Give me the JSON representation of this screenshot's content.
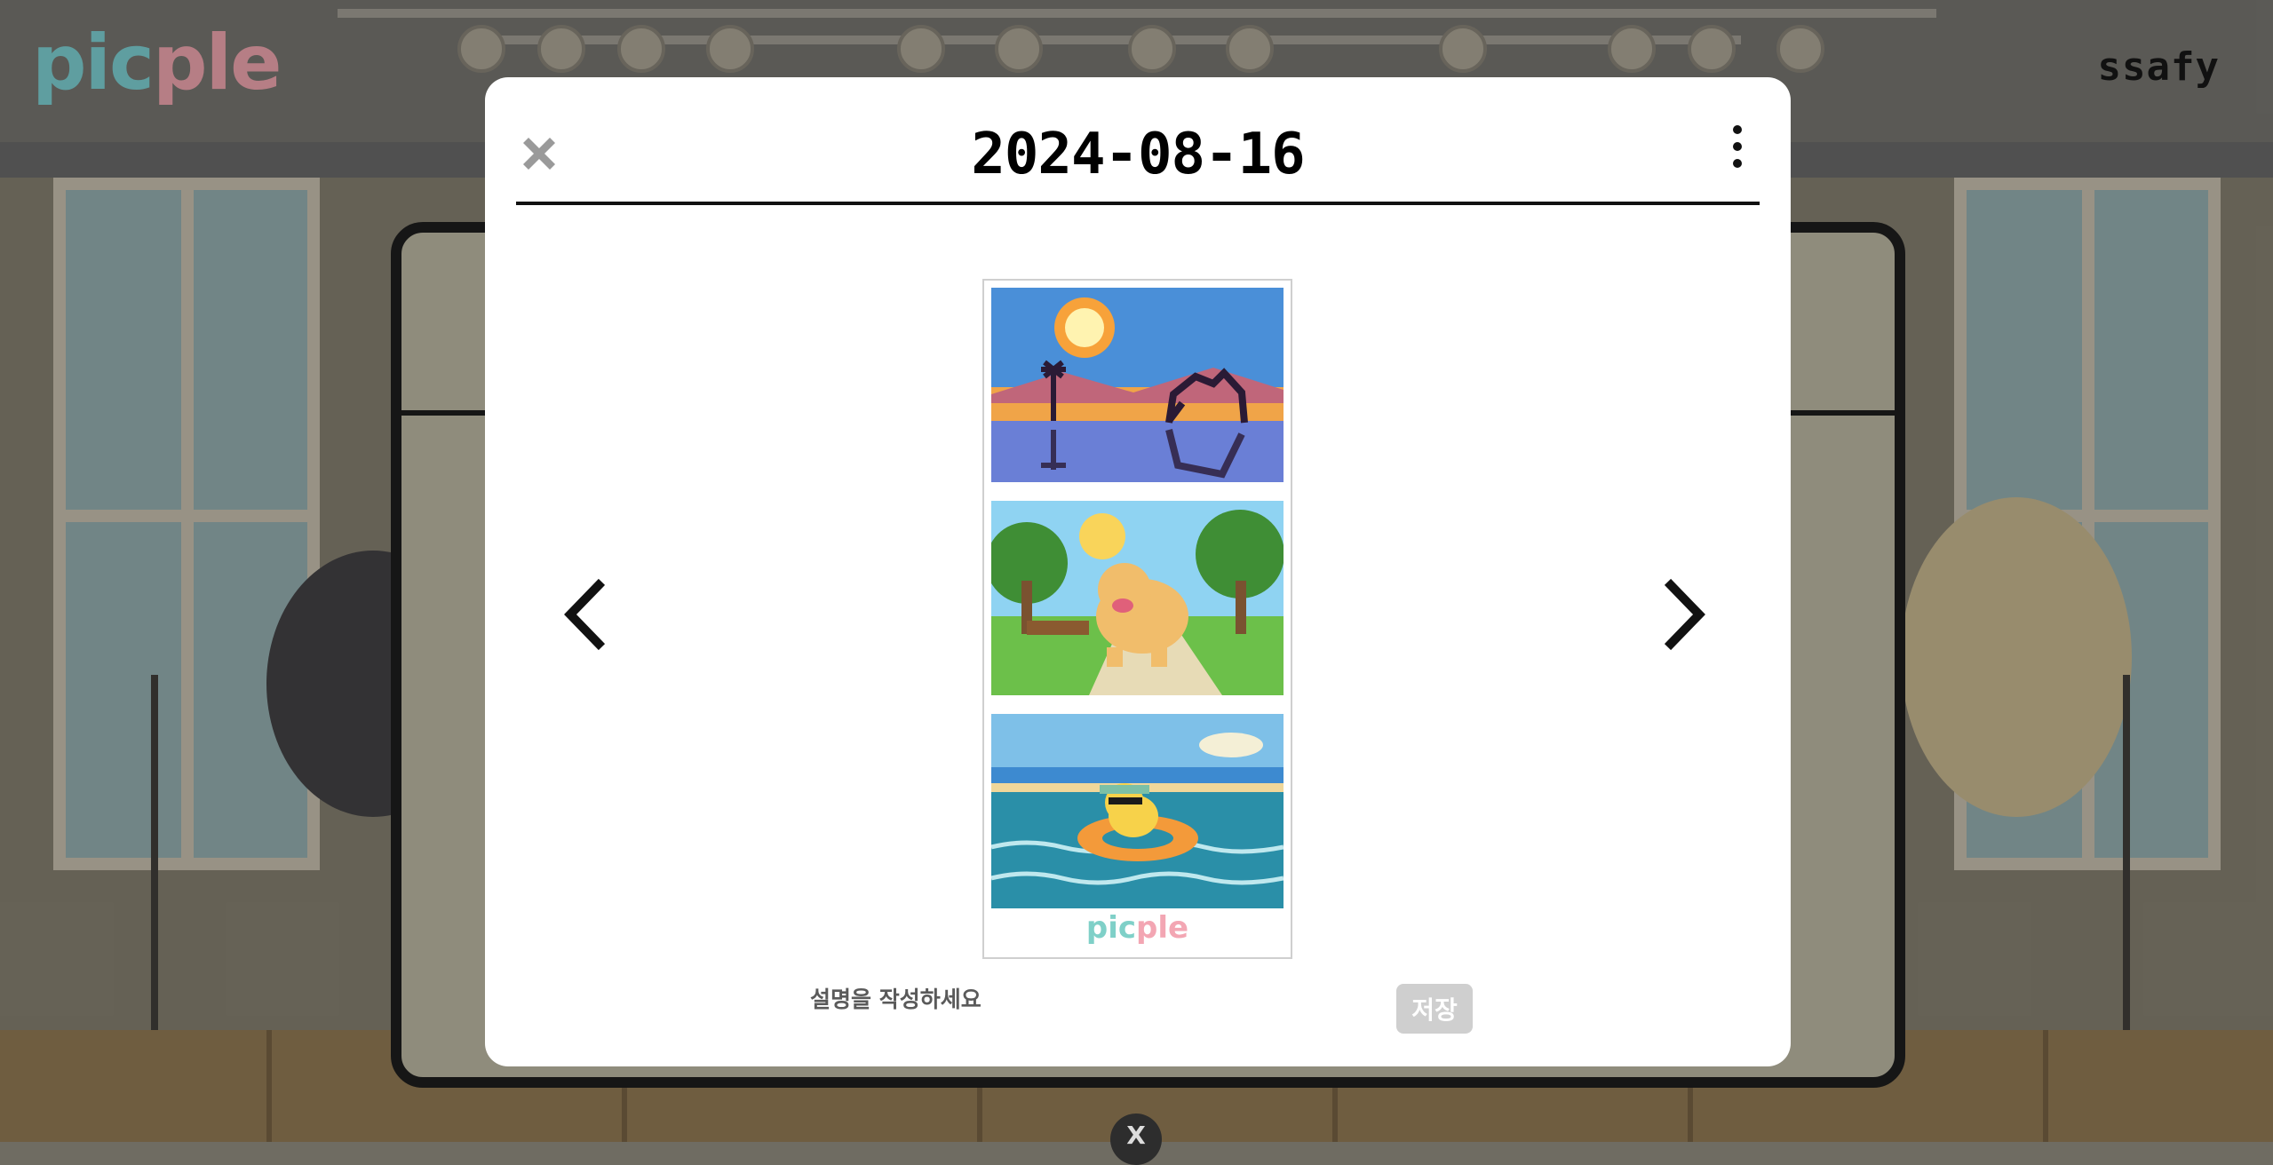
{
  "app": {
    "logo_pic": "pic",
    "logo_ple": "ple",
    "user_name": "ssafy"
  },
  "modal": {
    "title": "2024-08-16",
    "close_icon": "close-x-icon",
    "more_icon": "vertical-ellipsis-icon",
    "prev_icon": "chevron-left-icon",
    "next_icon": "chevron-right-icon",
    "photos": [
      {
        "name": "camel-oasis-pixel-art"
      },
      {
        "name": "golden-retriever-park-pixel-art"
      },
      {
        "name": "duck-float-sea-pixel-art"
      }
    ],
    "strip_logo_pic": "pic",
    "strip_logo_ple": "ple",
    "caption_placeholder": "설명을 작성하세요",
    "save_label": "저장"
  },
  "dock": {
    "label": "X"
  },
  "colors": {
    "modal_bg": "#ffffff",
    "save_disabled": "#cfcfcf",
    "brand_teal": "#7fd0c8",
    "brand_pink": "#f3a6b3"
  }
}
